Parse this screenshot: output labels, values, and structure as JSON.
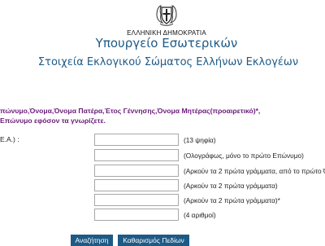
{
  "header": {
    "emblem_icon": "greek-coat-of-arms-icon",
    "government": "ΕΛΛΗΝΙΚΗ ΔΗΜΟΚΡΑΤΙΑ",
    "ministry": "Υπουργείο Εσωτερικών",
    "page_title": "Στοιχεία Εκλογικού Σώματος Ελλήνων Εκλογέων"
  },
  "instructions": {
    "line1": "πώνυμο,Όνομα,Όνομα Πατέρα,Έτος Γέννησης,Όνομα Μητέρας(προαιρετικό)*,",
    "line2": "Επώνυμο εφόσον τα γνωρίζετε."
  },
  "form": {
    "first_label": "Ε.Α.) :",
    "fields": [
      {
        "value": "",
        "hint": "(13 ψηφία)"
      },
      {
        "value": "",
        "hint": "(Ολογράφως, μόνο το πρώτο Επώνυμο)"
      },
      {
        "value": "",
        "hint": "(Αρκούν τα 2 πρώτα γράμματα, από το πρώτο Όν"
      },
      {
        "value": "",
        "hint": "(Αρκούν τα 2 πρώτα γράμματα)"
      },
      {
        "value": "",
        "hint": "(Αρκούν τα 2 πρώτα γράμματα)*"
      },
      {
        "value": "",
        "hint": "(4 αριθμοί)"
      }
    ]
  },
  "buttons": {
    "search": "Αναζήτηση",
    "clear": "Καθαρισμός Πεδίων"
  },
  "colors": {
    "accent": "#1d5a86",
    "note": "#6a1a7a"
  }
}
